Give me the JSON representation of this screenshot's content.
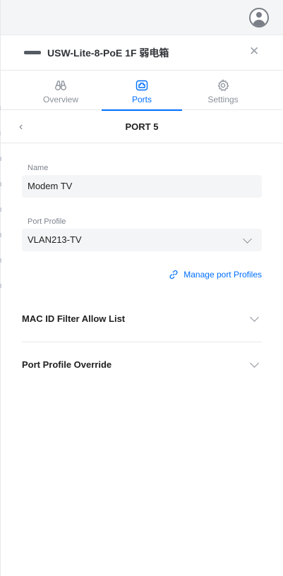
{
  "user": {
    "avatar_icon": "user-circle-icon"
  },
  "device": {
    "icon": "switch-device-icon",
    "name": "USW-Lite-8-PoE 1F 弱电箱"
  },
  "tabs": [
    {
      "label": "Overview",
      "icon": "binoculars-icon",
      "active": false
    },
    {
      "label": "Ports",
      "icon": "port-icon",
      "active": true
    },
    {
      "label": "Settings",
      "icon": "gear-icon",
      "active": false
    }
  ],
  "port": {
    "title": "PORT 5"
  },
  "form": {
    "name_label": "Name",
    "name_value": "Modem TV",
    "profile_label": "Port Profile",
    "profile_value": "VLAN213-TV",
    "manage_link": "Manage port Profiles"
  },
  "sections": [
    {
      "title": "MAC ID Filter Allow List"
    },
    {
      "title": "Port Profile Override"
    }
  ],
  "colors": {
    "accent": "#006fff",
    "text": "#212121",
    "muted": "#7d838c",
    "field_bg": "#f4f5f6"
  }
}
